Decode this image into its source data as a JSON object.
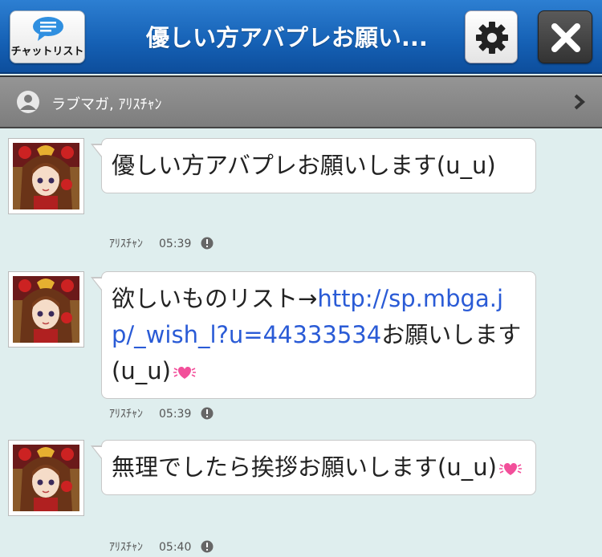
{
  "header": {
    "chatlist_label": "チャットリスト",
    "title": "優しい方アバプレお願い..."
  },
  "subbar": {
    "participants": "ラブマガ, ｱﾘｽﾁｬﾝ"
  },
  "messages": [
    {
      "text_before": "優しい方アバプレお願いします(u_u)",
      "link": "",
      "text_after": "",
      "has_heart": false,
      "sender": "ｱﾘｽﾁｬﾝ",
      "time": "05:39"
    },
    {
      "text_before": "欲しいものリスト→",
      "link": "http://sp.mbga.jp/_wish_l?u=44333534",
      "text_after": "お願いします(u_u)",
      "has_heart": true,
      "sender": "ｱﾘｽﾁｬﾝ",
      "time": "05:39"
    },
    {
      "text_before": "無理でしたら挨拶お願いします(u_u)",
      "link": "",
      "text_after": "",
      "has_heart": true,
      "sender": "ｱﾘｽﾁｬﾝ",
      "time": "05:40"
    }
  ],
  "icons": {
    "chat": "chat-bubble-icon",
    "settings": "gear-icon",
    "close": "close-icon",
    "user": "user-icon",
    "chevron": "chevron-right-icon",
    "warning": "warning-icon",
    "heart": "heart-emoji-icon"
  },
  "colors": {
    "header": "#1560b4",
    "link": "#2a5bd6",
    "background": "#dfeeee"
  }
}
